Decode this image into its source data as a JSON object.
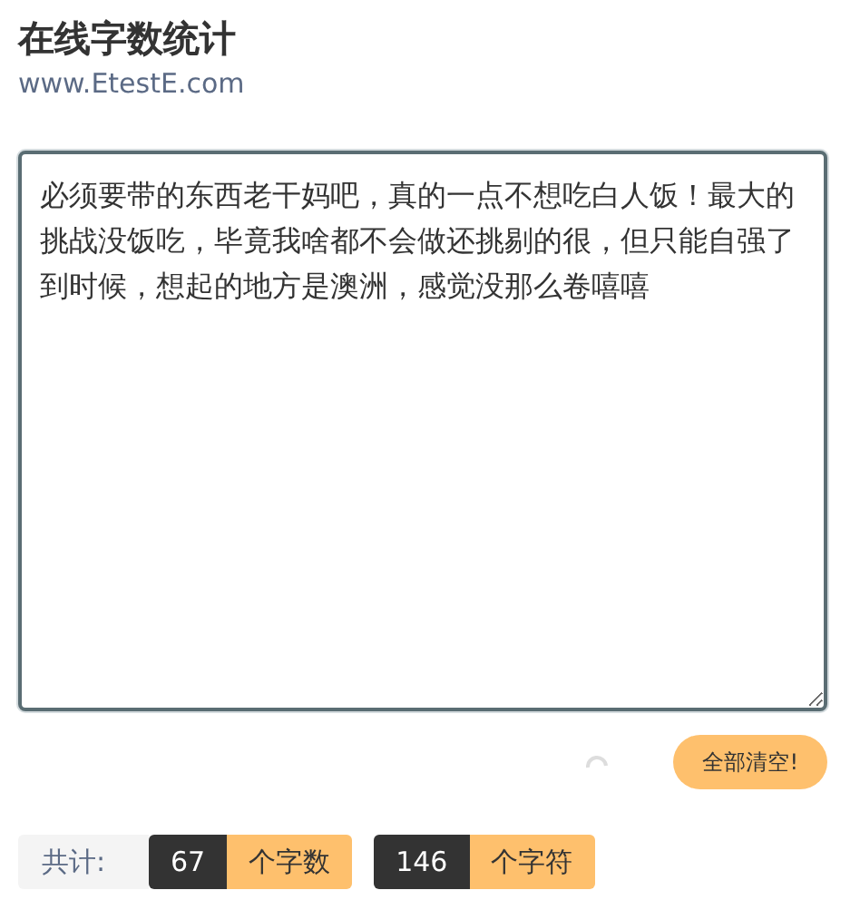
{
  "header": {
    "title": "在线字数统计",
    "subtitle": "www.EtestE.com"
  },
  "editor": {
    "value": "必须要带的东西老干妈吧，真的一点不想吃白人饭！最大的挑战没饭吃，毕竟我啥都不会做还挑剔的很，但只能自强了到时候，想起的地方是澳洲，感觉没那么卷嘻嘻"
  },
  "actions": {
    "clear_button": "全部清空!"
  },
  "stats": {
    "label": "共计:",
    "counts": [
      {
        "value": "67",
        "unit": "个字数"
      },
      {
        "value": "146",
        "unit": "个字符"
      }
    ]
  }
}
